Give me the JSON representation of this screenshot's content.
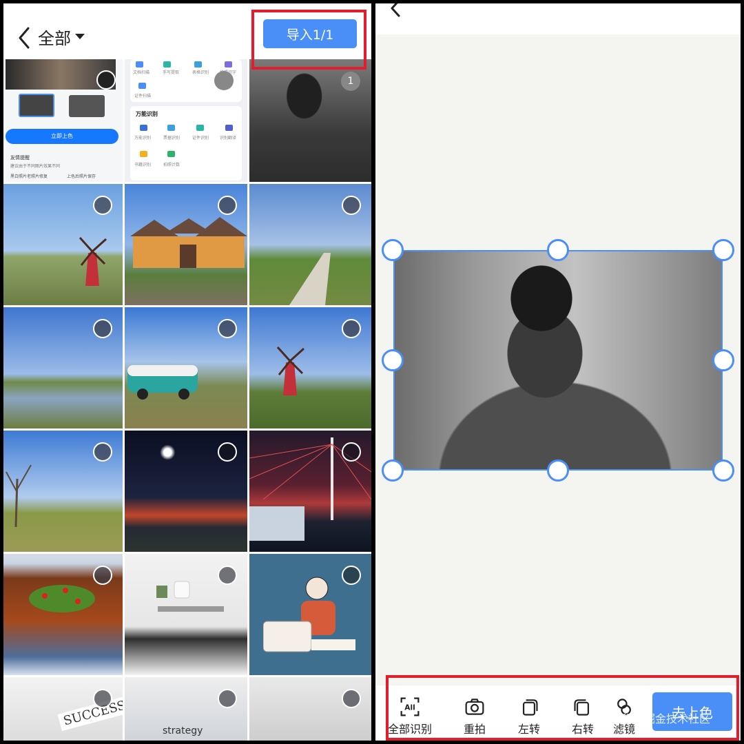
{
  "left": {
    "header": {
      "album_label": "全部",
      "import_label": "导入1/1"
    },
    "selected_badge": "1",
    "screenshot_tile": {
      "button_label": "立即上色",
      "text1": "友情提醒",
      "text2": "建议由于不同图片效果不同",
      "option1": "黑白照片老照片修复",
      "option2": "上色后照片保存"
    },
    "screenshot_tile2": {
      "section_title": "万能识别",
      "row1": [
        "文档扫描",
        "手写提取",
        "表格识别",
        "拍照识字"
      ],
      "row1b": [
        "证件扫描"
      ],
      "row2": [
        "万能识别",
        "票据识别",
        "证件识别",
        "识别翻译"
      ],
      "row2b": [
        "书籍识别",
        "拍照计数"
      ]
    },
    "tile_images": [
      "screenshot",
      "screenshot",
      "man-portrait",
      "windmill",
      "yellow-house",
      "path-field",
      "lake",
      "camper-van",
      "windmill-2",
      "tree-field",
      "night-bridge",
      "cable-bridge",
      "fish-dish",
      "desk",
      "illustration",
      "success-note",
      "strategy-box",
      "notebook"
    ],
    "misc_text": {
      "success": "SUCCESS",
      "strategy": "strategy"
    }
  },
  "right": {
    "toolbar": {
      "items": [
        {
          "icon": "all-recognize-icon",
          "label": "全部识别"
        },
        {
          "icon": "camera-icon",
          "label": "重拍"
        },
        {
          "icon": "rotate-left-icon",
          "label": "左转"
        },
        {
          "icon": "rotate-right-icon",
          "label": "右转"
        },
        {
          "icon": "filter-icon",
          "label": "滤镜"
        }
      ],
      "color_button": "去上色",
      "all_icon_text": "All"
    },
    "watermark": "@稀土掘金技术社区"
  },
  "colors": {
    "accent": "#4A8EF7",
    "highlight": "#E41D2D"
  }
}
